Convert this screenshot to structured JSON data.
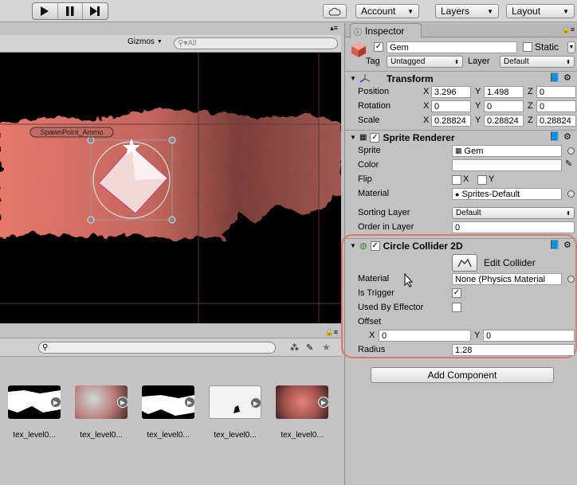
{
  "toolbar": {
    "account_label": "Account",
    "layers_label": "Layers",
    "layout_label": "Layout",
    "play_icon": "play-icon",
    "pause_icon": "pause-icon",
    "step_icon": "step-icon",
    "cloud_icon": "cloud-icon"
  },
  "scene": {
    "gizmos_label": "Gizmos",
    "search_placeholder": "All",
    "spawn_label": "SpawnPoint_Ammo"
  },
  "project": {
    "assets": [
      {
        "label": "tex_level0..."
      },
      {
        "label": "tex_level0..."
      },
      {
        "label": "tex_level0..."
      },
      {
        "label": "tex_level0..."
      },
      {
        "label": "tex_level0..."
      }
    ]
  },
  "inspector": {
    "tab_label": "Inspector",
    "object_name": "Gem",
    "static_label": "Static",
    "tag_label": "Tag",
    "tag_value": "Untagged",
    "layer_label": "Layer",
    "layer_value": "Default",
    "transform": {
      "title": "Transform",
      "position_label": "Position",
      "rotation_label": "Rotation",
      "scale_label": "Scale",
      "x_label": "X",
      "y_label": "Y",
      "z_label": "Z",
      "position": {
        "x": "3.296",
        "y": "1.498",
        "z": "0"
      },
      "rotation": {
        "x": "0",
        "y": "0",
        "z": "0"
      },
      "scale": {
        "x": "0.28824",
        "y": "0.28824",
        "z": "0.28824"
      }
    },
    "sprite_renderer": {
      "title": "Sprite Renderer",
      "sprite_label": "Sprite",
      "sprite_value": "Gem",
      "color_label": "Color",
      "flip_label": "Flip",
      "flip_x": "X",
      "flip_y": "Y",
      "material_label": "Material",
      "material_value": "Sprites-Default",
      "sorting_layer_label": "Sorting Layer",
      "sorting_layer_value": "Default",
      "order_label": "Order in Layer",
      "order_value": "0"
    },
    "circle_collider": {
      "title": "Circle Collider 2D",
      "edit_label": "Edit Collider",
      "material_label": "Material",
      "material_value": "None (Physics Material",
      "is_trigger_label": "Is Trigger",
      "is_trigger_checked": true,
      "used_by_effector_label": "Used By Effector",
      "offset_label": "Offset",
      "offset_x_label": "X",
      "offset_y_label": "Y",
      "offset_x": "0",
      "offset_y": "0",
      "radius_label": "Radius",
      "radius_value": "1.28"
    },
    "add_component_label": "Add Component",
    "highlight_color": "#d97a6a"
  }
}
